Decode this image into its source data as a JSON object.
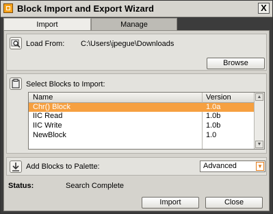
{
  "window": {
    "title": "Block Import and Export Wizard",
    "close_glyph": "X"
  },
  "tabs": [
    {
      "label": "Import",
      "active": true
    },
    {
      "label": "Manage",
      "active": false
    }
  ],
  "load_from": {
    "label": "Load From:",
    "path": "C:\\Users\\jpegue\\Downloads",
    "browse_label": "Browse",
    "icon": "search-folder-icon"
  },
  "select_blocks": {
    "label": "Select Blocks to Import:",
    "icon": "clipboard-icon",
    "columns": [
      "Name",
      "Version"
    ],
    "rows": [
      {
        "name": "Chr() Block",
        "version": "1.0a",
        "selected": true
      },
      {
        "name": "IIC Read",
        "version": "1.0b",
        "selected": false
      },
      {
        "name": "IIC Write",
        "version": "1.0b",
        "selected": false
      },
      {
        "name": "NewBlock",
        "version": "1.0",
        "selected": false
      }
    ],
    "selection_color": "#f6a040"
  },
  "palette": {
    "label": "Add Blocks to Palette:",
    "icon": "download-arrow-icon",
    "selected_option": "Advanced"
  },
  "status": {
    "label": "Status:",
    "value": "Search Complete"
  },
  "footer": {
    "import_label": "Import",
    "close_label": "Close"
  },
  "colors": {
    "accent": "#f6a21a",
    "panel": "#d5d3cd",
    "frame": "#3c3c3c"
  }
}
